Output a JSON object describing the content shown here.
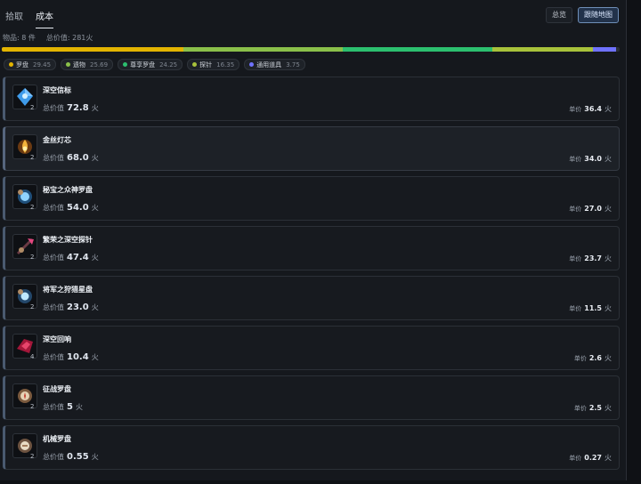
{
  "tabs": [
    {
      "label": "拾取"
    },
    {
      "label": "成本"
    }
  ],
  "header_buttons": {
    "summary": "总览",
    "follow_map": "跟随地图"
  },
  "meta": {
    "items": "物品: 8 件",
    "total_value": "总价值: 281火"
  },
  "distribution": {
    "colors": [
      "#e3b400",
      "#8ac04a",
      "#2cbf6f",
      "#a8c23b",
      "#6f72ff"
    ],
    "fractions": [
      0.2945,
      0.2569,
      0.2425,
      0.1635,
      0.0375
    ]
  },
  "legend": [
    {
      "label": "罗盘",
      "pct": "29.45",
      "color": "#e3b400"
    },
    {
      "label": "遗物",
      "pct": "25.69",
      "color": "#8ac04a"
    },
    {
      "label": "尊享罗盘",
      "pct": "24.25",
      "color": "#2cbf6f"
    },
    {
      "label": "探针",
      "pct": "16.35",
      "color": "#a8c23b"
    },
    {
      "label": "通用道具",
      "pct": "3.75",
      "color": "#6f72ff"
    }
  ],
  "labels": {
    "total_prefix": "总价值",
    "unit_prefix": "单价",
    "currency": "火"
  },
  "items": [
    {
      "name": "深空信标",
      "qty": "2",
      "total": "72.8",
      "unit": "36.4",
      "icon": "blue-crystal-icon"
    },
    {
      "name": "金丝灯芯",
      "qty": "2",
      "total": "68.0",
      "unit": "34.0",
      "icon": "golden-flame-icon"
    },
    {
      "name": "秘宝之众神罗盘",
      "qty": "2",
      "total": "54.0",
      "unit": "27.0",
      "icon": "blue-compass-icon"
    },
    {
      "name": "繁荣之深空探针",
      "qty": "2",
      "total": "47.4",
      "unit": "23.7",
      "icon": "pink-probe-icon"
    },
    {
      "name": "将军之狩猎星盘",
      "qty": "2",
      "total": "23.0",
      "unit": "11.5",
      "icon": "star-compass-icon"
    },
    {
      "name": "深空回响",
      "qty": "4",
      "total": "10.4",
      "unit": "2.6",
      "icon": "red-echo-icon"
    },
    {
      "name": "征战罗盘",
      "qty": "2",
      "total": "5",
      "unit": "2.5",
      "icon": "bronze-compass-icon"
    },
    {
      "name": "机械罗盘",
      "qty": "2",
      "total": "0.55",
      "unit": "0.27",
      "icon": "mechanical-compass-icon"
    }
  ]
}
